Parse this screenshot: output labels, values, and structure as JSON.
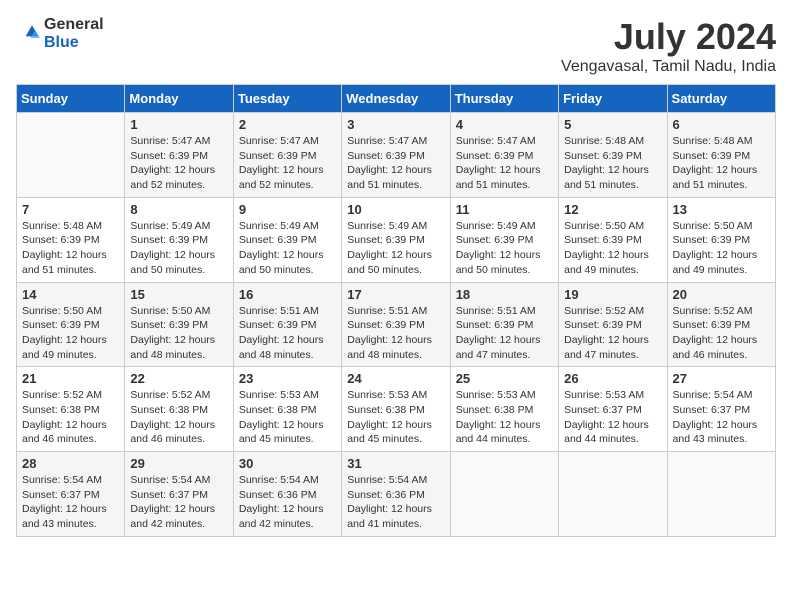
{
  "header": {
    "logo_general": "General",
    "logo_blue": "Blue",
    "month_year": "July 2024",
    "location": "Vengavasal, Tamil Nadu, India"
  },
  "calendar": {
    "days_of_week": [
      "Sunday",
      "Monday",
      "Tuesday",
      "Wednesday",
      "Thursday",
      "Friday",
      "Saturday"
    ],
    "weeks": [
      [
        {
          "day": "",
          "info": ""
        },
        {
          "day": "1",
          "info": "Sunrise: 5:47 AM\nSunset: 6:39 PM\nDaylight: 12 hours\nand 52 minutes."
        },
        {
          "day": "2",
          "info": "Sunrise: 5:47 AM\nSunset: 6:39 PM\nDaylight: 12 hours\nand 52 minutes."
        },
        {
          "day": "3",
          "info": "Sunrise: 5:47 AM\nSunset: 6:39 PM\nDaylight: 12 hours\nand 51 minutes."
        },
        {
          "day": "4",
          "info": "Sunrise: 5:47 AM\nSunset: 6:39 PM\nDaylight: 12 hours\nand 51 minutes."
        },
        {
          "day": "5",
          "info": "Sunrise: 5:48 AM\nSunset: 6:39 PM\nDaylight: 12 hours\nand 51 minutes."
        },
        {
          "day": "6",
          "info": "Sunrise: 5:48 AM\nSunset: 6:39 PM\nDaylight: 12 hours\nand 51 minutes."
        }
      ],
      [
        {
          "day": "7",
          "info": "Sunrise: 5:48 AM\nSunset: 6:39 PM\nDaylight: 12 hours\nand 51 minutes."
        },
        {
          "day": "8",
          "info": "Sunrise: 5:49 AM\nSunset: 6:39 PM\nDaylight: 12 hours\nand 50 minutes."
        },
        {
          "day": "9",
          "info": "Sunrise: 5:49 AM\nSunset: 6:39 PM\nDaylight: 12 hours\nand 50 minutes."
        },
        {
          "day": "10",
          "info": "Sunrise: 5:49 AM\nSunset: 6:39 PM\nDaylight: 12 hours\nand 50 minutes."
        },
        {
          "day": "11",
          "info": "Sunrise: 5:49 AM\nSunset: 6:39 PM\nDaylight: 12 hours\nand 50 minutes."
        },
        {
          "day": "12",
          "info": "Sunrise: 5:50 AM\nSunset: 6:39 PM\nDaylight: 12 hours\nand 49 minutes."
        },
        {
          "day": "13",
          "info": "Sunrise: 5:50 AM\nSunset: 6:39 PM\nDaylight: 12 hours\nand 49 minutes."
        }
      ],
      [
        {
          "day": "14",
          "info": "Sunrise: 5:50 AM\nSunset: 6:39 PM\nDaylight: 12 hours\nand 49 minutes."
        },
        {
          "day": "15",
          "info": "Sunrise: 5:50 AM\nSunset: 6:39 PM\nDaylight: 12 hours\nand 48 minutes."
        },
        {
          "day": "16",
          "info": "Sunrise: 5:51 AM\nSunset: 6:39 PM\nDaylight: 12 hours\nand 48 minutes."
        },
        {
          "day": "17",
          "info": "Sunrise: 5:51 AM\nSunset: 6:39 PM\nDaylight: 12 hours\nand 48 minutes."
        },
        {
          "day": "18",
          "info": "Sunrise: 5:51 AM\nSunset: 6:39 PM\nDaylight: 12 hours\nand 47 minutes."
        },
        {
          "day": "19",
          "info": "Sunrise: 5:52 AM\nSunset: 6:39 PM\nDaylight: 12 hours\nand 47 minutes."
        },
        {
          "day": "20",
          "info": "Sunrise: 5:52 AM\nSunset: 6:39 PM\nDaylight: 12 hours\nand 46 minutes."
        }
      ],
      [
        {
          "day": "21",
          "info": "Sunrise: 5:52 AM\nSunset: 6:38 PM\nDaylight: 12 hours\nand 46 minutes."
        },
        {
          "day": "22",
          "info": "Sunrise: 5:52 AM\nSunset: 6:38 PM\nDaylight: 12 hours\nand 46 minutes."
        },
        {
          "day": "23",
          "info": "Sunrise: 5:53 AM\nSunset: 6:38 PM\nDaylight: 12 hours\nand 45 minutes."
        },
        {
          "day": "24",
          "info": "Sunrise: 5:53 AM\nSunset: 6:38 PM\nDaylight: 12 hours\nand 45 minutes."
        },
        {
          "day": "25",
          "info": "Sunrise: 5:53 AM\nSunset: 6:38 PM\nDaylight: 12 hours\nand 44 minutes."
        },
        {
          "day": "26",
          "info": "Sunrise: 5:53 AM\nSunset: 6:37 PM\nDaylight: 12 hours\nand 44 minutes."
        },
        {
          "day": "27",
          "info": "Sunrise: 5:54 AM\nSunset: 6:37 PM\nDaylight: 12 hours\nand 43 minutes."
        }
      ],
      [
        {
          "day": "28",
          "info": "Sunrise: 5:54 AM\nSunset: 6:37 PM\nDaylight: 12 hours\nand 43 minutes."
        },
        {
          "day": "29",
          "info": "Sunrise: 5:54 AM\nSunset: 6:37 PM\nDaylight: 12 hours\nand 42 minutes."
        },
        {
          "day": "30",
          "info": "Sunrise: 5:54 AM\nSunset: 6:36 PM\nDaylight: 12 hours\nand 42 minutes."
        },
        {
          "day": "31",
          "info": "Sunrise: 5:54 AM\nSunset: 6:36 PM\nDaylight: 12 hours\nand 41 minutes."
        },
        {
          "day": "",
          "info": ""
        },
        {
          "day": "",
          "info": ""
        },
        {
          "day": "",
          "info": ""
        }
      ]
    ]
  }
}
